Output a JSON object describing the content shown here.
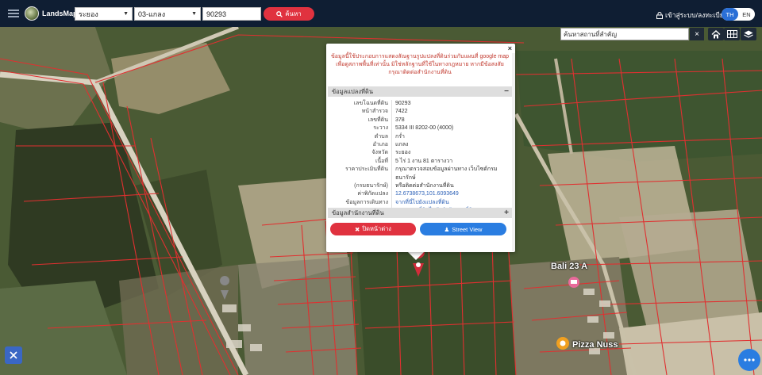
{
  "app": {
    "brand": "LandsMaps"
  },
  "search": {
    "province": "ระยอง",
    "district": "03-แกลง",
    "parcel_no": "90293",
    "search_label": "ค้นหา"
  },
  "auth": {
    "login_label": "เข้าสู่ระบบ/ลงทะเบียน"
  },
  "lang": {
    "active": "TH",
    "other": "EN"
  },
  "map": {
    "place_search_placeholder": "ค้นหาสถานที่สำคัญ",
    "clear_label": "×",
    "labels": {
      "bali": "Bali 23 A",
      "pizza": "Pizza Nuss"
    }
  },
  "popup": {
    "close": "×",
    "notice": "ข้อมูลนี้ใช้ประกอบการแสดงสัณฐานรูปแปลงที่ดินร่วมกับแผนที่ google map เพื่อดูสภาพพื้นที่เท่านั้น มิใช่หลักฐานที่ใช้ในทางกฎหมาย หากมีข้อสงสัย กรุณาติดต่อสำนักงานที่ดิน",
    "section_parcel": "ข้อมูลแปลงที่ดิน",
    "section_parcel_toggle": "−",
    "section_office": "ข้อมูลสำนักงานที่ดิน",
    "section_office_toggle": "+",
    "rows": [
      {
        "label": "เลขโฉนดที่ดิน",
        "value": "90293"
      },
      {
        "label": "หน้าสำรวจ",
        "value": "7422"
      },
      {
        "label": "เลขที่ดิน",
        "value": "378"
      },
      {
        "label": "ระวาง",
        "value": "5334 III 8202-00 (4000)"
      },
      {
        "label": "ตำบล",
        "value": "กร่ำ"
      },
      {
        "label": "อำเภอ",
        "value": "แกลง"
      },
      {
        "label": "จังหวัด",
        "value": "ระยอง"
      },
      {
        "label": "เนื้อที่",
        "value": "5 ไร่ 1 งาน 81 ตารางวา"
      },
      {
        "label": "ราคาประเมินที่ดิน",
        "value": "กรุณาตรวจสอบข้อมูลผ่านทาง เว็บไซต์กรมธนารักษ์"
      },
      {
        "label": "(กรมธนารักษ์)",
        "value": "หรือติดต่อสำนักงานที่ดิน"
      },
      {
        "label": "ค่าพิกัดแปลง",
        "value": "12.6738673,101.6093649",
        "link": true
      },
      {
        "label": "ข้อมูลการเดินทาง",
        "value": "จากที่นี่ไปยังแปลงที่ดิน",
        "link": true
      },
      {
        "label": "",
        "value": "จากแปลงที่ดินไปยังสำนักงานที่ดิน",
        "link": true
      }
    ],
    "btn_panorama": "ปิดหน้าต่าง",
    "btn_streetview": "Street View"
  },
  "colors": {
    "accent_red": "#e0323f",
    "accent_blue": "#2a7de1",
    "topbar": "#0f1e33",
    "parcel_line": "#e03030"
  }
}
